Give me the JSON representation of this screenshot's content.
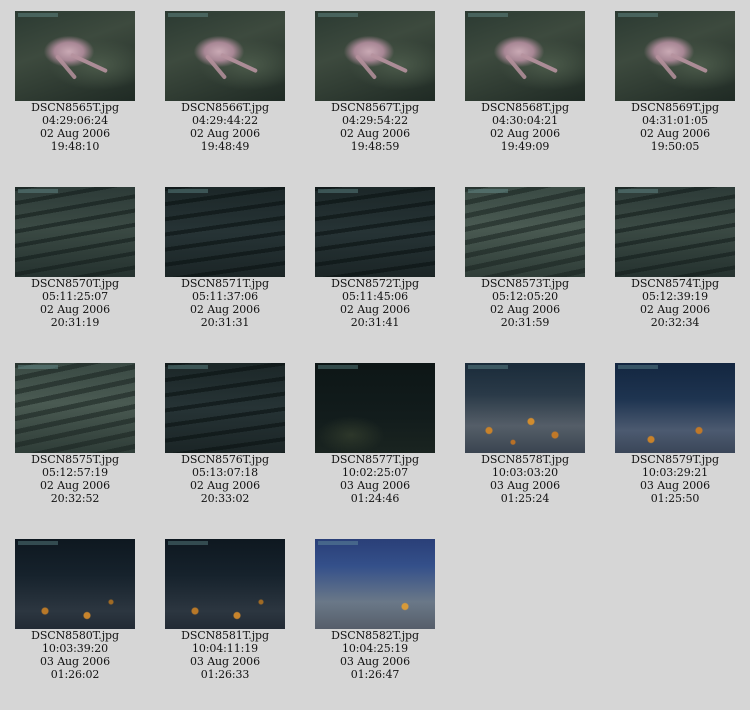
{
  "thumbnails": [
    {
      "filename": "DSCN8565T.jpg",
      "timecode": "04:29:06:24",
      "date": "02 Aug 2006",
      "time": "19:48:10",
      "style": "octopus"
    },
    {
      "filename": "DSCN8566T.jpg",
      "timecode": "04:29:44:22",
      "date": "02 Aug 2006",
      "time": "19:48:49",
      "style": "octopus"
    },
    {
      "filename": "DSCN8567T.jpg",
      "timecode": "04:29:54:22",
      "date": "02 Aug 2006",
      "time": "19:48:59",
      "style": "octopus"
    },
    {
      "filename": "DSCN8568T.jpg",
      "timecode": "04:30:04:21",
      "date": "02 Aug 2006",
      "time": "19:49:09",
      "style": "octopus"
    },
    {
      "filename": "DSCN8569T.jpg",
      "timecode": "04:31:01:05",
      "date": "02 Aug 2006",
      "time": "19:50:05",
      "style": "octopus"
    },
    {
      "filename": "DSCN8570T.jpg",
      "timecode": "05:11:25:07",
      "date": "02 Aug 2006",
      "time": "20:31:19",
      "style": "rock"
    },
    {
      "filename": "DSCN8571T.jpg",
      "timecode": "05:11:37:06",
      "date": "02 Aug 2006",
      "time": "20:31:31",
      "style": "rock dark"
    },
    {
      "filename": "DSCN8572T.jpg",
      "timecode": "05:11:45:06",
      "date": "02 Aug 2006",
      "time": "20:31:41",
      "style": "rock dark"
    },
    {
      "filename": "DSCN8573T.jpg",
      "timecode": "05:12:05:20",
      "date": "02 Aug 2006",
      "time": "20:31:59",
      "style": "rock light"
    },
    {
      "filename": "DSCN8574T.jpg",
      "timecode": "05:12:39:19",
      "date": "02 Aug 2006",
      "time": "20:32:34",
      "style": "rock"
    },
    {
      "filename": "DSCN8575T.jpg",
      "timecode": "05:12:57:19",
      "date": "02 Aug 2006",
      "time": "20:32:52",
      "style": "rock light"
    },
    {
      "filename": "DSCN8576T.jpg",
      "timecode": "05:13:07:18",
      "date": "02 Aug 2006",
      "time": "20:33:02",
      "style": "rock dark"
    },
    {
      "filename": "DSCN8577T.jpg",
      "timecode": "10:02:25:07",
      "date": "03 Aug 2006",
      "time": "01:24:46",
      "style": "deep"
    },
    {
      "filename": "DSCN8578T.jpg",
      "timecode": "10:03:03:20",
      "date": "03 Aug 2006",
      "time": "01:25:24",
      "style": "seafloor"
    },
    {
      "filename": "DSCN8579T.jpg",
      "timecode": "10:03:29:21",
      "date": "03 Aug 2006",
      "time": "01:25:50",
      "style": "seafloor blue"
    },
    {
      "filename": "DSCN8580T.jpg",
      "timecode": "10:03:39:20",
      "date": "03 Aug 2006",
      "time": "01:26:02",
      "style": "seafloor dark"
    },
    {
      "filename": "DSCN8581T.jpg",
      "timecode": "10:04:11:19",
      "date": "03 Aug 2006",
      "time": "01:26:33",
      "style": "seafloor dark"
    },
    {
      "filename": "DSCN8582T.jpg",
      "timecode": "10:04:25:19",
      "date": "03 Aug 2006",
      "time": "01:26:47",
      "style": "seafloor bright"
    }
  ]
}
